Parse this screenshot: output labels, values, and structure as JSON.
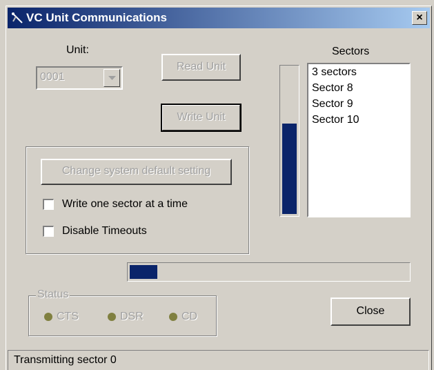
{
  "window": {
    "title": "VC Unit Communications",
    "close_label": "×"
  },
  "unit": {
    "label": "Unit:",
    "value": "0001"
  },
  "buttons": {
    "read_unit": "Read Unit",
    "write_unit": "Write Unit",
    "change_default": "Change system default setting",
    "close": "Close"
  },
  "options": {
    "write_one_sector": "Write one sector at a time",
    "disable_timeouts": "Disable Timeouts"
  },
  "sectors": {
    "label": "Sectors",
    "items": [
      "3 sectors",
      "Sector 8",
      "Sector 9",
      "Sector 10"
    ],
    "progress_fraction": 0.62
  },
  "transfer_progress_fraction": 0.1,
  "status": {
    "label": "Status",
    "cts": "CTS",
    "dsr": "DSR",
    "cd": "CD"
  },
  "statusbar": {
    "text": "Transmitting sector 0"
  },
  "colors": {
    "titlebar_start": "#0a246a",
    "titlebar_end": "#a6caf0",
    "progress_fill": "#0a246a",
    "face": "#d4d0c8",
    "led_off": "#808040"
  }
}
